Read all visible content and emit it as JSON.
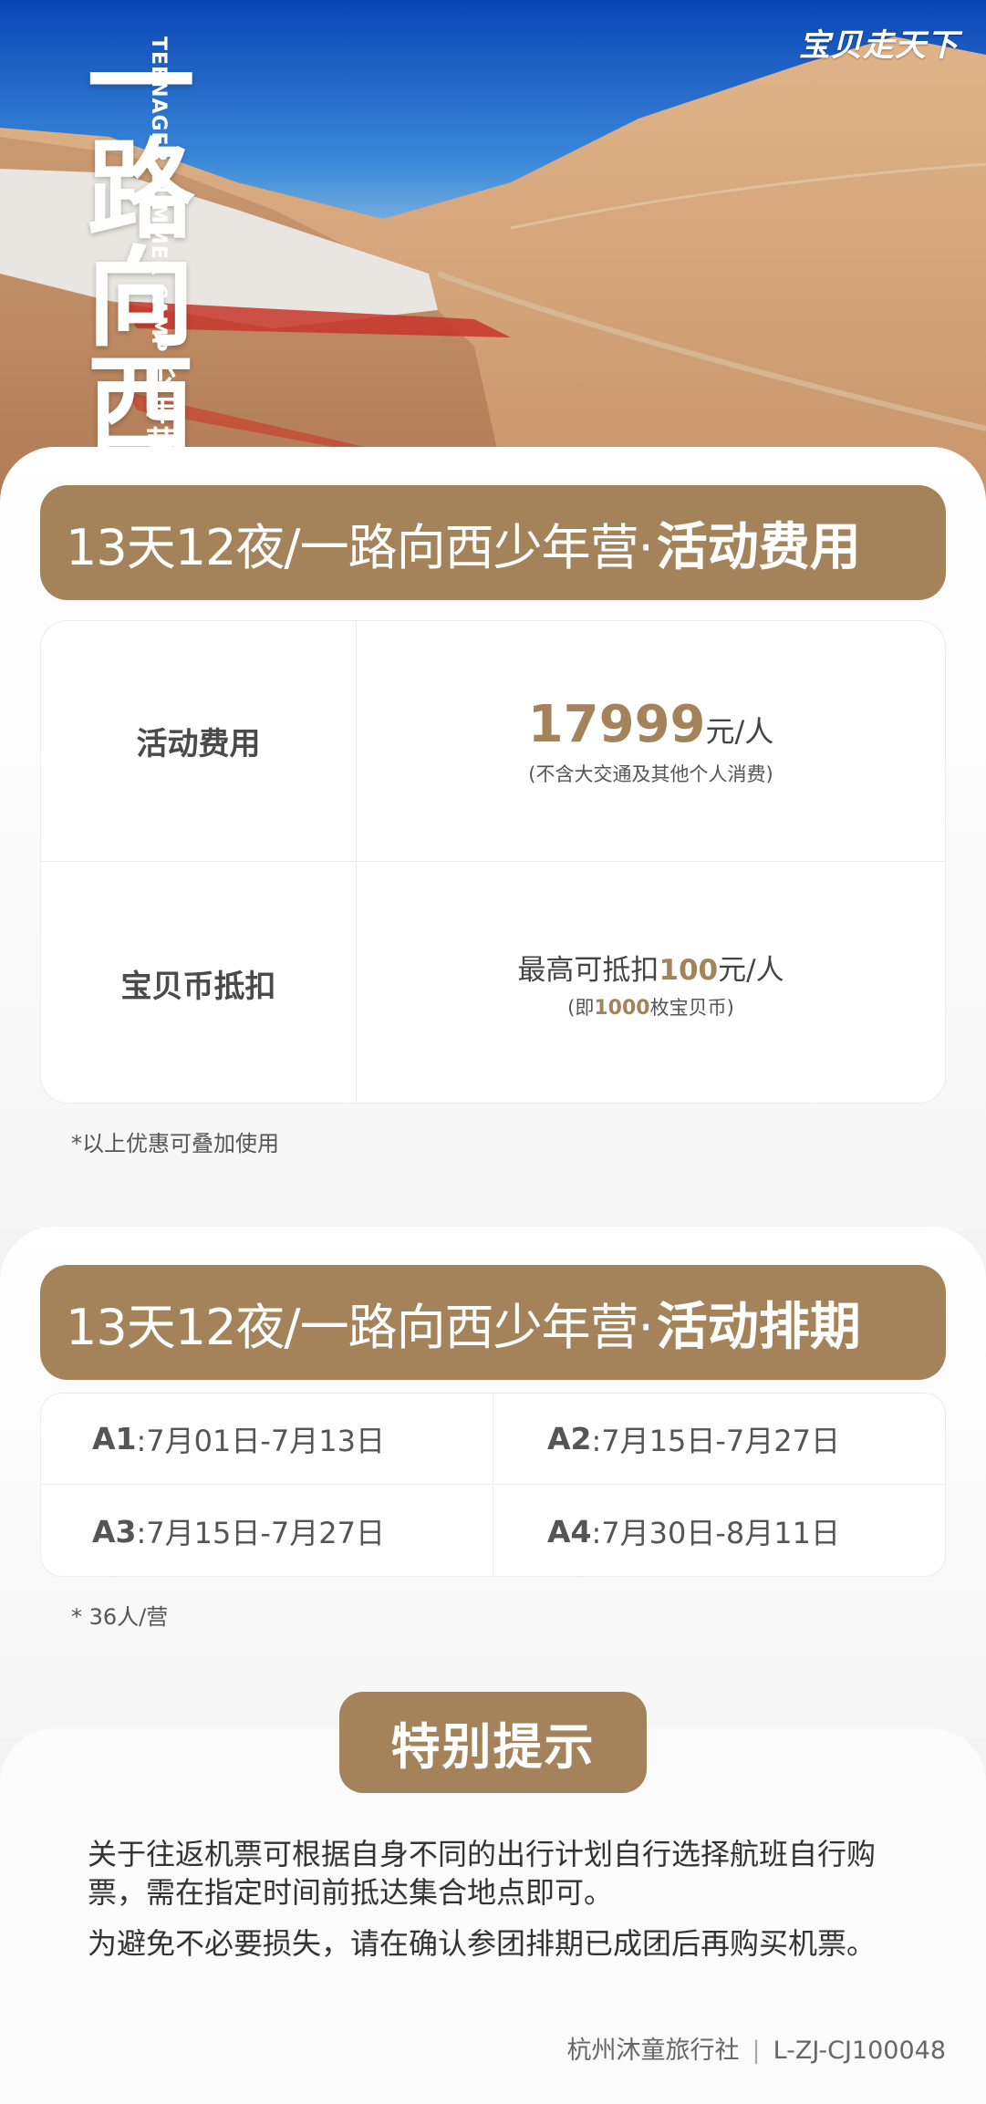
{
  "hero": {
    "brand": "宝贝走天下",
    "title": "一路向西",
    "subtitle_cn": "少年营",
    "subtitle_en_1": "TEENAGER",
    "subtitle_en_2": "SUMMER CAMP"
  },
  "fee_section": {
    "banner_light": "13天12夜/一路向西少年营·",
    "banner_bold": "活动费用",
    "rows": [
      {
        "label": "活动费用",
        "price": "17999",
        "unit": "元/人",
        "note": "(不含大交通及其他个人消费)"
      },
      {
        "label": "宝贝币抵扣",
        "text_prefix": "最高可抵扣",
        "amount": "100",
        "text_suffix": "元/人",
        "note_prefix": "(即",
        "note_amount": "1000",
        "note_suffix": "枚宝贝币)"
      }
    ],
    "footnote": "*以上优惠可叠加使用"
  },
  "schedule_section": {
    "banner_light": "13天12夜/一路向西少年营·",
    "banner_bold": "活动排期",
    "items": [
      {
        "code": "A1",
        "dates": ":7月01日-7月13日"
      },
      {
        "code": "A2",
        "dates": ":7月15日-7月27日"
      },
      {
        "code": "A3",
        "dates": ":7月15日-7月27日"
      },
      {
        "code": "A4",
        "dates": ":7月30日-8月11日"
      }
    ],
    "footnote": "* 36人/营"
  },
  "notice_section": {
    "title": "特别提示",
    "paragraphs": [
      "关于往返机票可根据自身不同的出行计划自行选择航班自行购票，需在指定时间前抵达集合地点即可。",
      "为避免不必要损失，请在确认参团排期已成团后再购买机票。"
    ],
    "agency_name": "杭州沐童旅行社",
    "separator": "|",
    "license": "L-ZJ-CJ100048"
  },
  "colors": {
    "accent": "#a5835a",
    "sky": "#2d7fd8",
    "desert": "#c98d62"
  }
}
